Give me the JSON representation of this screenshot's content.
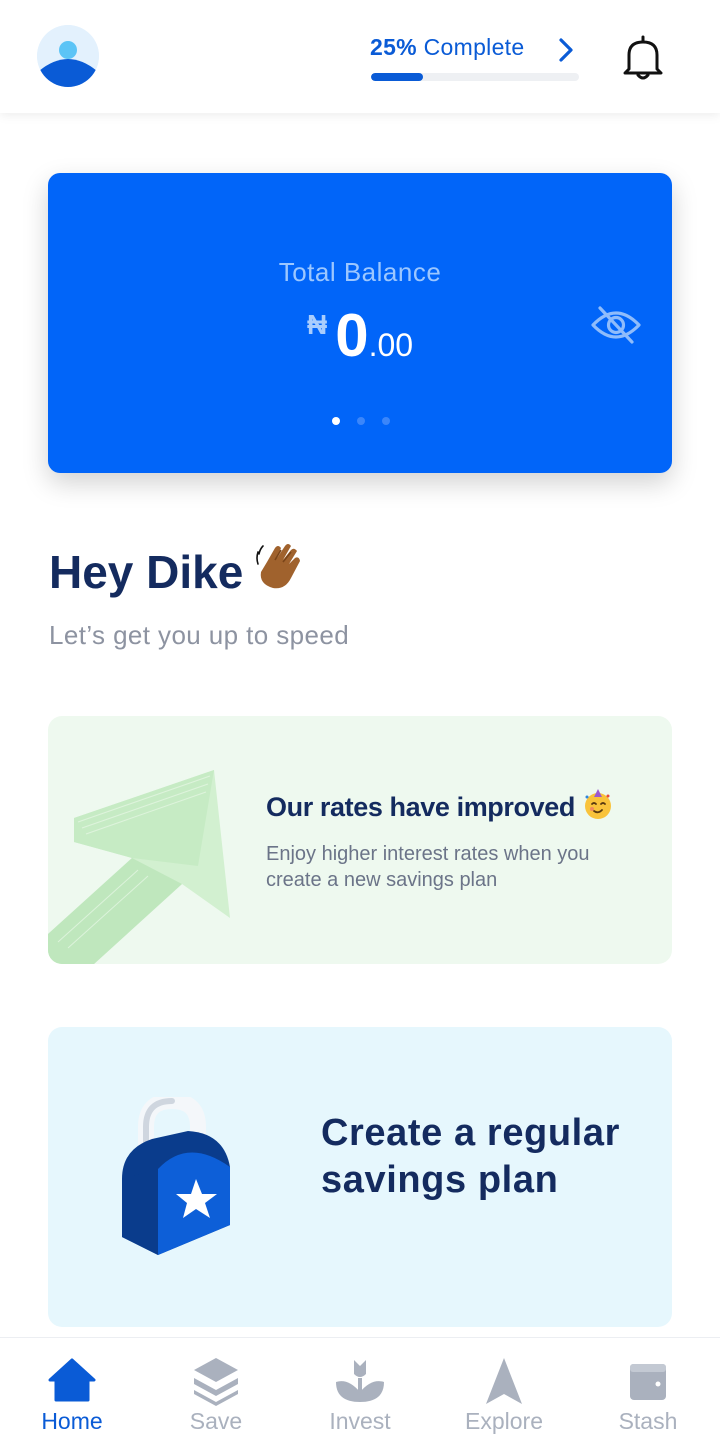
{
  "header": {
    "progress": {
      "percent_text": "25%",
      "label_text": " Complete",
      "fraction": 0.25
    }
  },
  "balance_card": {
    "title": "Total Balance",
    "currency": "₦",
    "amount_whole": "0",
    "amount_decimal": ".00",
    "active_slide": 1,
    "slide_count": 3
  },
  "greeting": {
    "title": "Hey Dike",
    "subtitle": "Let’s get you up to speed"
  },
  "rates_card": {
    "title": "Our rates have improved",
    "text": "Enjoy higher interest rates when you create a new savings plan"
  },
  "savings_card": {
    "title": "Create a regular savings plan"
  },
  "bottom_nav": {
    "items": [
      {
        "label": "Home",
        "icon": "home-icon",
        "active": true
      },
      {
        "label": "Save",
        "icon": "layers-icon",
        "active": false
      },
      {
        "label": "Invest",
        "icon": "plant-icon",
        "active": false
      },
      {
        "label": "Explore",
        "icon": "navigation-icon",
        "active": false
      },
      {
        "label": "Stash",
        "icon": "wallet-icon",
        "active": false
      }
    ]
  },
  "colors": {
    "primary": "#0165f9",
    "accent_text": "#0a5bd6",
    "heading": "#142b5f",
    "rates_bg": "#eef9ef",
    "savings_bg": "#e6f7fd",
    "nav_inactive": "#aab1be"
  }
}
